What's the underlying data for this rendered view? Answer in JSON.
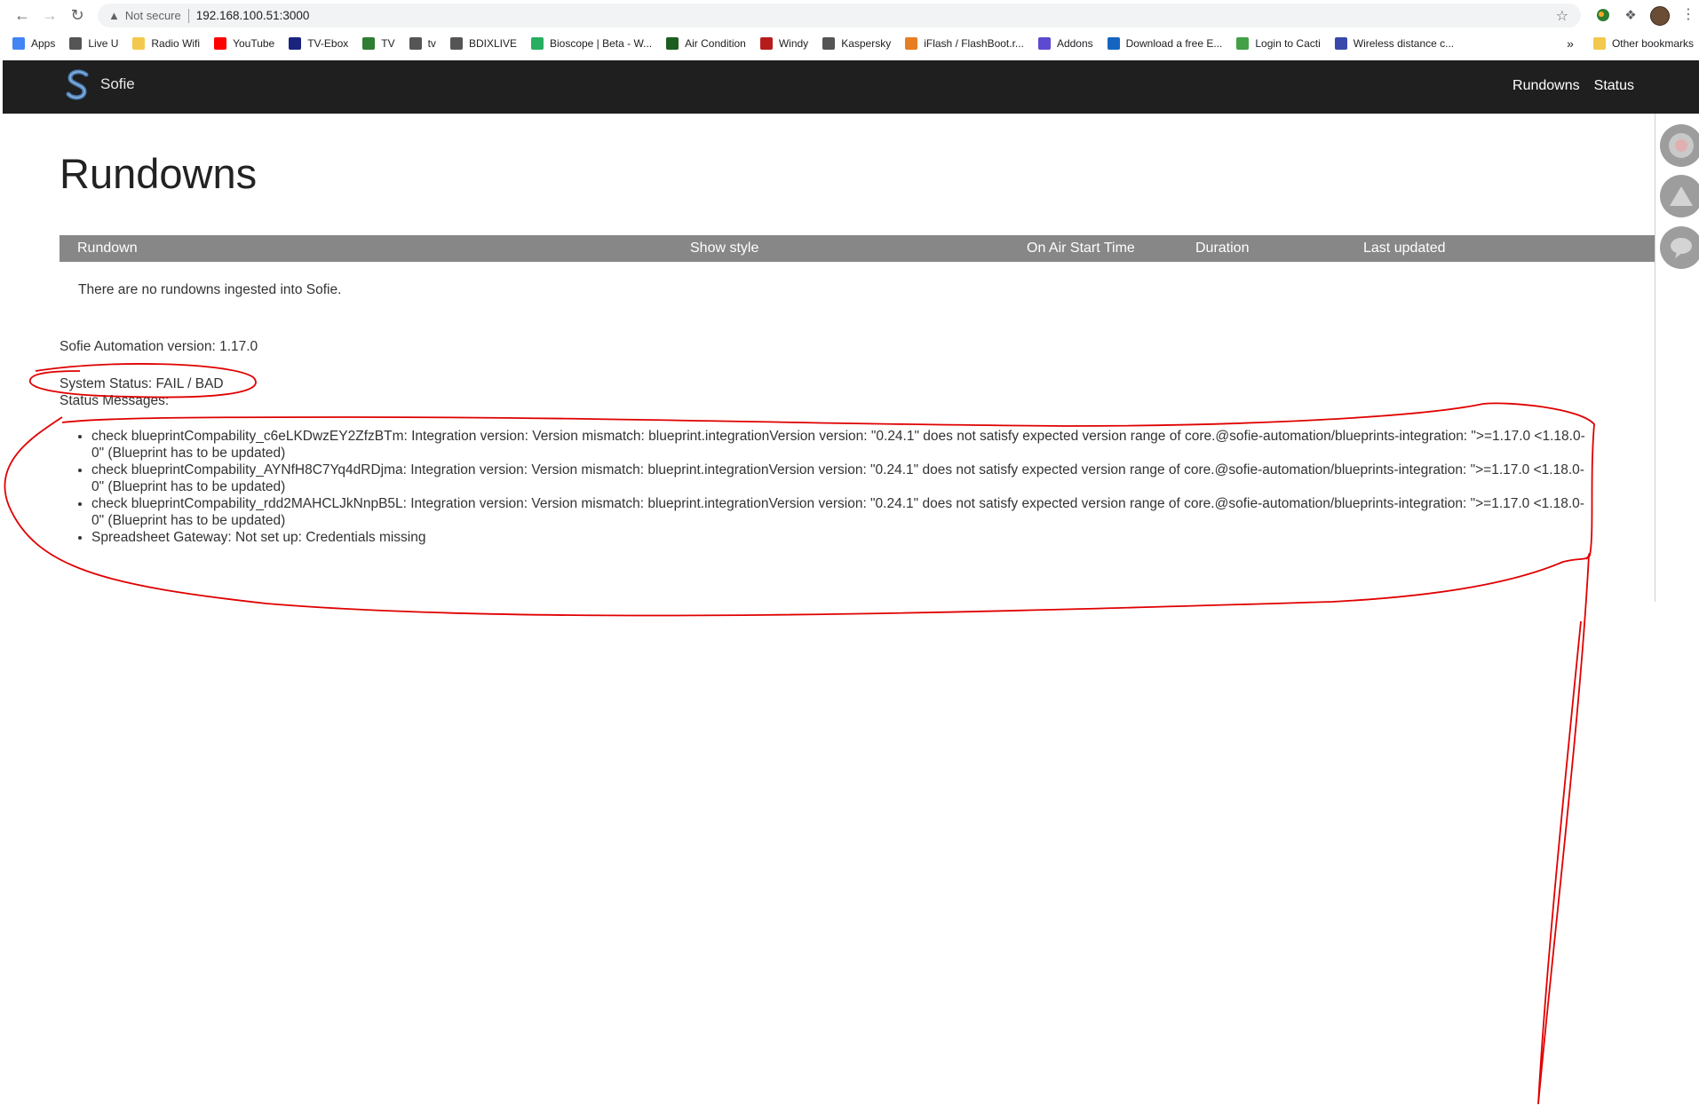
{
  "browser": {
    "not_secure": "Not secure",
    "url": "192.168.100.51:3000"
  },
  "bookmarks": [
    {
      "label": "Apps",
      "color": "#4285f4"
    },
    {
      "label": "Live U",
      "color": "#555555"
    },
    {
      "label": "Radio Wifi",
      "color": "#f2c94c"
    },
    {
      "label": "YouTube",
      "color": "#ff0000"
    },
    {
      "label": "TV-Ebox",
      "color": "#1a237e"
    },
    {
      "label": "TV",
      "color": "#2e7d32"
    },
    {
      "label": "tv",
      "color": "#555555"
    },
    {
      "label": "BDIXLIVE",
      "color": "#555555"
    },
    {
      "label": "Bioscope | Beta - W...",
      "color": "#27ae60"
    },
    {
      "label": "Air Condition",
      "color": "#1b5e20"
    },
    {
      "label": "Windy",
      "color": "#b71c1c"
    },
    {
      "label": "Kaspersky",
      "color": "#555555"
    },
    {
      "label": "iFlash / FlashBoot.r...",
      "color": "#e67e22"
    },
    {
      "label": "Addons",
      "color": "#5c4bd1"
    },
    {
      "label": "Download a free E...",
      "color": "#1565c0"
    },
    {
      "label": "Login to Cacti",
      "color": "#43a047"
    },
    {
      "label": "Wireless distance c...",
      "color": "#3949ab"
    }
  ],
  "bookmarks_overflow": "»",
  "other_bookmarks": "Other bookmarks",
  "app": {
    "brand": "Sofie",
    "nav": {
      "rundowns": "Rundowns",
      "status": "Status"
    }
  },
  "page": {
    "title": "Rundowns",
    "table_headers": {
      "rundown": "Rundown",
      "show_style": "Show style",
      "on_air_start_time": "On Air Start Time",
      "duration": "Duration",
      "last_updated": "Last updated"
    },
    "empty_message": "There are no rundowns ingested into Sofie.",
    "version": "Sofie Automation version: 1.17.0",
    "system_status": "System Status: FAIL / BAD",
    "status_messages_label": "Status Messages:",
    "status_messages": [
      "check blueprintCompability_c6eLKDwzEY2ZfzBTm: Integration version: Version mismatch: blueprint.integrationVersion version: \"0.24.1\" does not satisfy expected version range of core.@sofie-automation/blueprints-integration: \">=1.17.0 <1.18.0-0\" (Blueprint has to be updated)",
      "check blueprintCompability_AYNfH8C7Yq4dRDjma: Integration version: Version mismatch: blueprint.integrationVersion version: \"0.24.1\" does not satisfy expected version range of core.@sofie-automation/blueprints-integration: \">=1.17.0 <1.18.0-0\" (Blueprint has to be updated)",
      "check blueprintCompability_rdd2MAHCLJkNnpB5L: Integration version: Version mismatch: blueprint.integrationVersion version: \"0.24.1\" does not satisfy expected version range of core.@sofie-automation/blueprints-integration: \">=1.17.0 <1.18.0-0\" (Blueprint has to be updated)",
      "Spreadsheet Gateway: Not set up: Credentials missing"
    ]
  },
  "colors": {
    "header_bg": "#1f1f1f",
    "table_header_bg": "#878787",
    "annotation": "#e00000"
  }
}
